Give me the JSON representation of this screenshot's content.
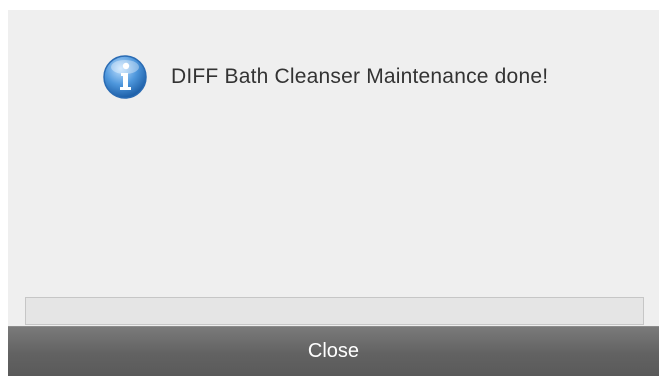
{
  "dialog": {
    "icon": "info-icon",
    "message": "DIFF Bath Cleanser  Maintenance done!",
    "close_label": "Close",
    "accent_color": "#3f84c8"
  }
}
